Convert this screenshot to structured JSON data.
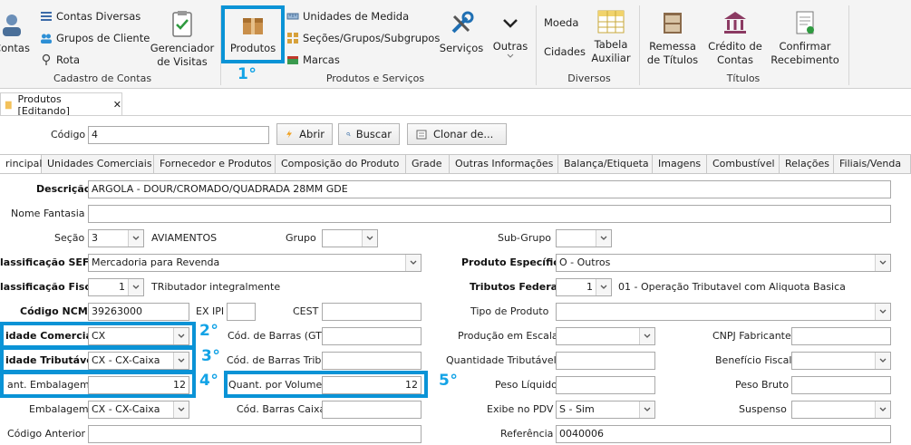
{
  "ribbon": {
    "cadastro": {
      "contas": "Contas",
      "contas_diversas": "Contas Diversas",
      "grupos_cliente": "Grupos de Cliente",
      "rota": "Rota",
      "gerenciador": "Gerenciador de Visitas",
      "group_title": "Cadastro de Contas"
    },
    "produtos": {
      "produtos": "Produtos",
      "unidades_medida": "Unidades de Medida",
      "secoes": "Seções/Grupos/Subgrupos",
      "marcas": "Marcas",
      "servicos": "Serviços",
      "outras": "Outras",
      "group_title": "Produtos e Serviços"
    },
    "diversos": {
      "moeda": "Moeda",
      "cidades": "Cidades",
      "tabela_auxiliar": "Tabela Auxiliar",
      "group_title": "Diversos"
    },
    "titulos": {
      "remessa": "Remessa de Títulos",
      "credito": "Crédito de Contas",
      "confirmar": "Confirmar Recebimento",
      "group_title": "Títulos"
    }
  },
  "annotations": {
    "s1": "1°",
    "s2": "2°",
    "s3": "3°",
    "s4": "4°",
    "s5": "5°"
  },
  "doc_tab": {
    "title": "Produtos [Editando]",
    "close": "✕"
  },
  "toolbar": {
    "codigo_label": "Código",
    "codigo_value": "4",
    "abrir": "Abrir",
    "buscar": "Buscar",
    "clonar": "Clonar de..."
  },
  "tabs": [
    "rincipal",
    "Unidades Comerciais",
    "Fornecedor e Produtos",
    "Composição do Produto",
    "Grade",
    "Outras Informações",
    "Balança/Etiqueta",
    "Imagens",
    "Combustível",
    "Relações",
    "Filiais/Venda"
  ],
  "form": {
    "descricao_label": "Descrição",
    "descricao_value": "ARGOLA - DOUR/CROMADO/QUADRADA 28MM GDE",
    "nome_fantasia_label": "Nome Fantasia",
    "secao_label": "Seção",
    "secao_value": "3",
    "secao_text": "AVIAMENTOS",
    "grupo_label": "Grupo",
    "subgrupo_label": "Sub-Grupo",
    "class_sefaz_label": "lassificação SEFAZ",
    "class_sefaz_value": "Mercadoria para Revenda",
    "produto_especifico_label": "Produto Específico",
    "produto_especifico_value": "O - Outros",
    "class_fiscal_label": "lassificação Fiscal",
    "class_fiscal_value": "1",
    "class_fiscal_text": "TRibutador integralmente",
    "tributos_label": "Tributos Federais",
    "tributos_value": "1",
    "tributos_text": "01 - Operação Tributavel com Aliquota Basica",
    "ncm_label": "Código NCM",
    "ncm_value": "39263000",
    "exipi_label": "EX IPI",
    "cest_label": "CEST",
    "tipo_produto_label": "Tipo de Produto",
    "un_comercial_label": "idade Comercial",
    "un_comercial_value": "CX",
    "cod_barras_gtin_label": "Cód. de Barras (GTIN)",
    "producao_escala_label": "Produção em Escala",
    "cnpj_fabricante_label": "CNPJ Fabricante",
    "un_tributavel_label": "idade Tributável",
    "un_tributavel_value": "CX - CX-Caixa",
    "cod_barras_trib_label": "Cód. de Barras Trib.",
    "quant_tributavel_label": "Quantidade Tributável",
    "beneficio_fiscal_label": "Benefício Fiscal",
    "quant_embalagem_label": "ant. Embalagem",
    "quant_embalagem_value": "12",
    "quant_volume_label": "Quant. por Volume",
    "quant_volume_value": "12",
    "peso_liquido_label": "Peso Líquido",
    "peso_bruto_label": "Peso Bruto",
    "embalagem_label": "Embalagem",
    "embalagem_value": "CX - CX-Caixa",
    "cod_barras_caixa_label": "Cód. Barras Caixa",
    "exibe_pdv_label": "Exibe no PDV",
    "exibe_pdv_value": "S - Sim",
    "suspenso_label": "Suspenso",
    "codigo_anterior_label": "Código Anterior",
    "referencia_label": "Referência",
    "referencia_value": "0040006"
  },
  "colors": {
    "highlight": "#0a93d6",
    "annotation": "#13a3e6"
  }
}
